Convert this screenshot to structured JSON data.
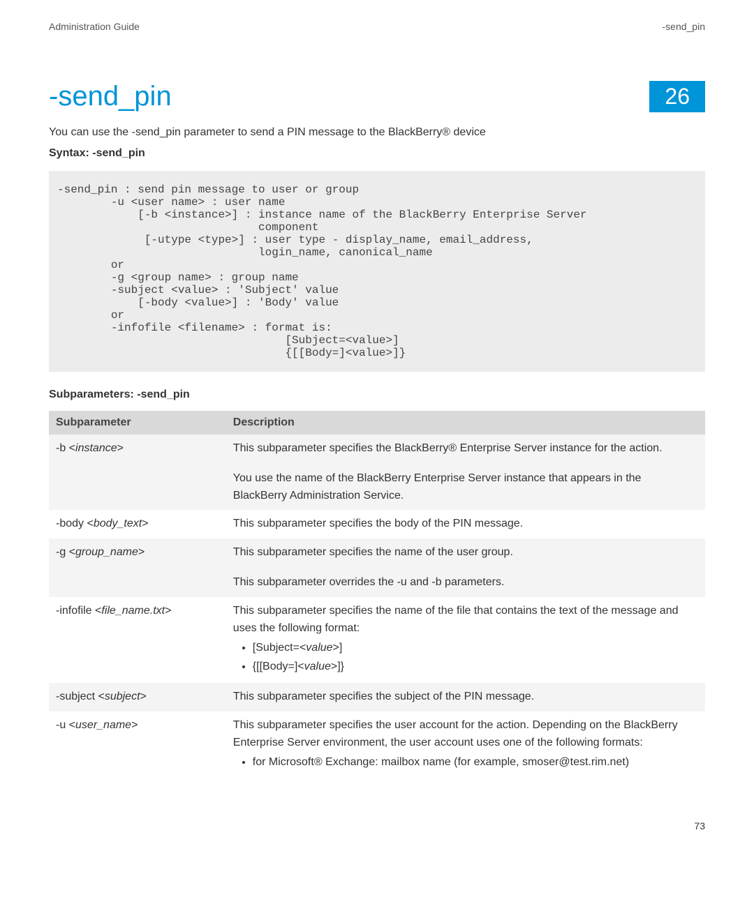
{
  "header": {
    "left": "Administration Guide",
    "right": "-send_pin"
  },
  "title": "-send_pin",
  "chapter": "26",
  "intro": "You can use the -send_pin parameter to send a PIN message to the BlackBerry® device",
  "syntax_label": "Syntax: -send_pin",
  "code": "-send_pin : send pin message to user or group\n        -u <user name> : user name\n            [-b <instance>] : instance name of the BlackBerry Enterprise Server\n                              component\n             [-utype <type>] : user type - display_name, email_address,\n                              login_name, canonical_name\n        or\n        -g <group name> : group name\n        -subject <value> : 'Subject' value\n            [-body <value>] : 'Body' value\n        or\n        -infofile <filename> : format is:\n                                  [Subject=<value>]\n                                  {[[Body=]<value>]}",
  "subparams_label": "Subparameters: -send_pin",
  "table": {
    "head": {
      "c1": "Subparameter",
      "c2": "Description"
    },
    "rows": [
      {
        "param_prefix": "-b <",
        "param_ital": "instance",
        "param_suffix": ">",
        "desc_lines": [
          "This subparameter specifies the BlackBerry® Enterprise Server instance for the action.",
          "You use the name of the BlackBerry Enterprise Server instance that appears in the BlackBerry Administration Service."
        ]
      },
      {
        "param_prefix": "-body <",
        "param_ital": "body_text",
        "param_suffix": ">",
        "desc_lines": [
          "This subparameter specifies the body of the PIN message."
        ]
      },
      {
        "param_prefix": "-g <",
        "param_ital": "group_name",
        "param_suffix": ">",
        "desc_lines": [
          "This subparameter specifies the name of the user group.",
          "This subparameter overrides the -u and -b parameters."
        ]
      },
      {
        "param_prefix": "-infofile <",
        "param_ital": "file_name.txt",
        "param_suffix": ">",
        "desc_lines": [
          "This subparameter specifies the name of the file that contains the text of the message and uses the following format:"
        ],
        "bullets": [
          {
            "pre": "[Subject=<",
            "ital": "value",
            "post": ">]"
          },
          {
            "pre": "{[[Body=]<",
            "ital": "value",
            "post": ">]}"
          }
        ]
      },
      {
        "param_prefix": "-subject <",
        "param_ital": "subject",
        "param_suffix": ">",
        "desc_lines": [
          "This subparameter specifies the subject of the PIN message."
        ]
      },
      {
        "param_prefix": "-u <",
        "param_ital": "user_name",
        "param_suffix": ">",
        "desc_lines": [
          "This subparameter specifies the user account for the action. Depending on the BlackBerry Enterprise Server environment, the user account uses one of the following formats:"
        ],
        "bullets": [
          {
            "pre": "for Microsoft® Exchange: mailbox name (for example, smoser@test.rim.net)",
            "ital": "",
            "post": ""
          }
        ]
      }
    ]
  },
  "page_number": "73"
}
